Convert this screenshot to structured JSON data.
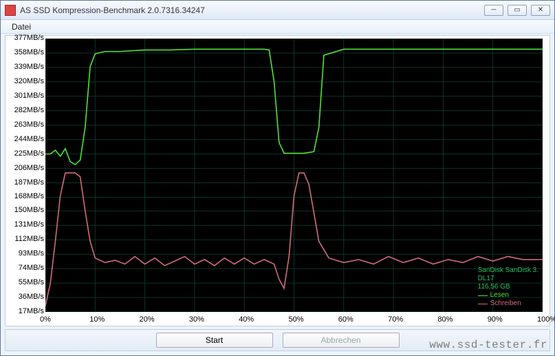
{
  "window": {
    "title": "AS SSD Kompression-Benchmark 2.0.7316.34247",
    "minimize_glyph": "─",
    "maximize_glyph": "▭",
    "close_glyph": "✕"
  },
  "menubar": {
    "file_label": "Datei"
  },
  "footer": {
    "start_label": "Start",
    "cancel_label": "Abbrechen"
  },
  "watermark": "www.ssd-tester.fr",
  "device": {
    "name": "SanDisk SanDisk 3.",
    "fw": "DL17",
    "capacity": "116,56 GB"
  },
  "legend": {
    "read": "Lesen",
    "write": "Schreiben"
  },
  "colors": {
    "read": "#53e234",
    "write": "#d46b7c",
    "device_text": "#26c060",
    "grid": "#0a3528"
  },
  "chart_data": {
    "type": "line",
    "xlabel": "",
    "ylabel": "",
    "x_unit": "%",
    "y_unit": "MB/s",
    "xlim": [
      0,
      100
    ],
    "ylim": [
      17,
      377
    ],
    "y_ticks": [
      17,
      36,
      55,
      74,
      93,
      112,
      131,
      150,
      168,
      187,
      206,
      225,
      244,
      263,
      282,
      301,
      320,
      339,
      358,
      377
    ],
    "x_ticks": [
      0,
      10,
      20,
      30,
      40,
      50,
      60,
      70,
      80,
      90,
      100
    ],
    "series": [
      {
        "name": "Lesen",
        "color": "#53e234",
        "x": [
          0,
          1,
          2,
          3,
          4,
          5,
          6,
          7,
          8,
          9,
          10,
          12,
          15,
          20,
          25,
          30,
          35,
          40,
          44,
          45,
          46,
          47,
          48,
          49,
          50,
          51,
          52,
          53,
          54,
          55,
          56,
          60,
          65,
          70,
          75,
          80,
          85,
          90,
          92,
          95,
          100
        ],
        "y": [
          225,
          225,
          230,
          222,
          232,
          215,
          211,
          217,
          260,
          340,
          357,
          360,
          360,
          362,
          362,
          363,
          363,
          363,
          363,
          362,
          320,
          240,
          226,
          226,
          226,
          226,
          226,
          227,
          228,
          260,
          355,
          363,
          363,
          363,
          363,
          363,
          363,
          363,
          363,
          363,
          363
        ]
      },
      {
        "name": "Schreiben",
        "color": "#d46b7c",
        "x": [
          0,
          1,
          2,
          3,
          4,
          5,
          6,
          7,
          8,
          9,
          10,
          12,
          14,
          16,
          18,
          20,
          22,
          24,
          26,
          28,
          30,
          32,
          34,
          36,
          38,
          40,
          42,
          44,
          46,
          47,
          48,
          49,
          50,
          51,
          52,
          53,
          55,
          57,
          60,
          63,
          66,
          69,
          72,
          75,
          78,
          81,
          84,
          87,
          90,
          93,
          96,
          100
        ],
        "y": [
          25,
          55,
          110,
          170,
          200,
          200,
          200,
          195,
          150,
          110,
          88,
          82,
          85,
          80,
          90,
          80,
          88,
          78,
          84,
          90,
          80,
          86,
          78,
          88,
          80,
          88,
          80,
          86,
          80,
          60,
          48,
          90,
          170,
          200,
          200,
          185,
          110,
          88,
          82,
          86,
          80,
          90,
          82,
          88,
          80,
          86,
          82,
          90,
          84,
          90,
          86,
          86
        ]
      }
    ]
  }
}
